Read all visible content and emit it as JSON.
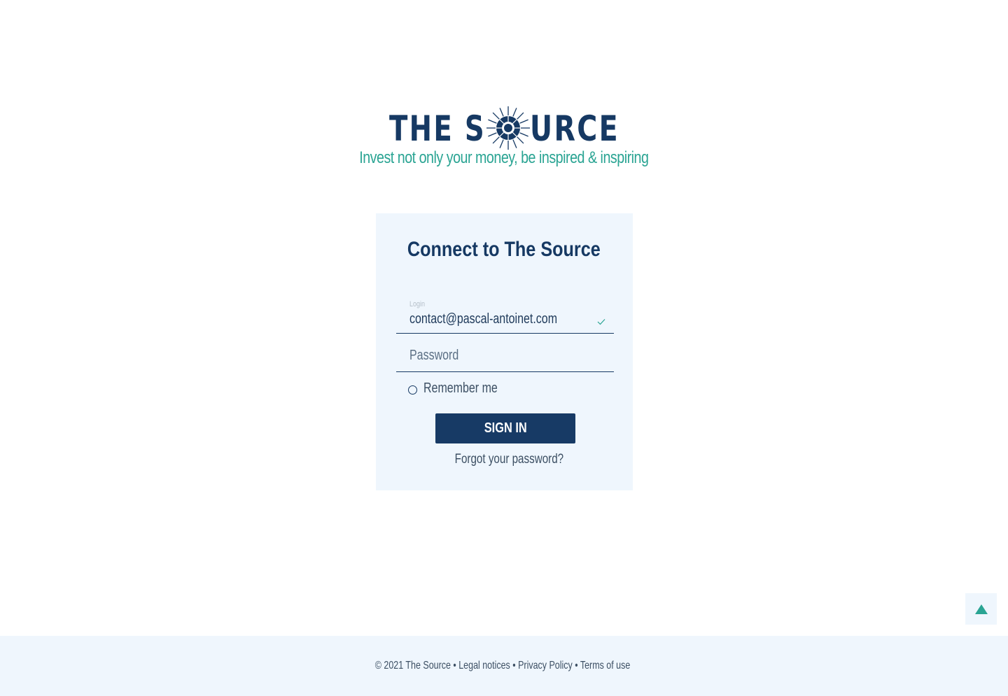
{
  "brand": {
    "logo_text_left": "THE S",
    "logo_text_right": "URCE",
    "tagline": "Invest not only your money, be inspired & inspiring",
    "colors": {
      "navy": "#163963",
      "teal": "#2aa493",
      "panel": "#eff6fd"
    }
  },
  "login_form": {
    "title": "Connect to The Source",
    "login_label": "Login",
    "login_value": "contact@pascal-antoinet.com",
    "login_status_icon": "check-icon",
    "password_placeholder": "Password",
    "remember_label": "Remember me",
    "remember_checked": false,
    "submit_label": "SIGN IN",
    "forgot_label": "Forgot your password?"
  },
  "scroll_top": {
    "icon": "arrow-up-icon"
  },
  "footer": {
    "copyright": "© 2021 The Source",
    "separator": " • ",
    "links": [
      "Legal notices",
      "Privacy Policy",
      "Terms of use"
    ]
  }
}
